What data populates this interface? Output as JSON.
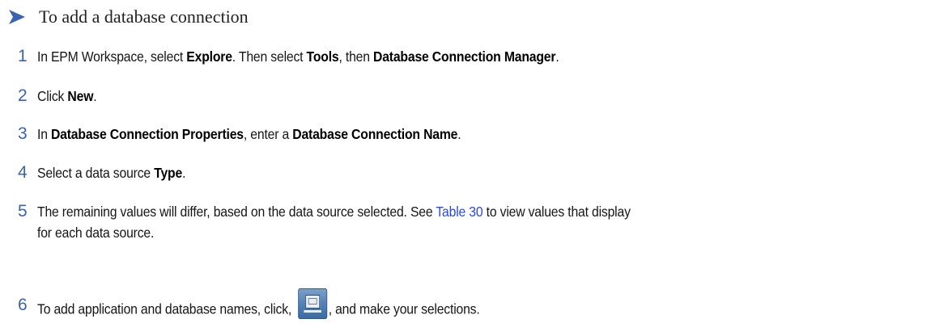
{
  "heading": "To add a database connection",
  "steps": [
    {
      "num": "1",
      "parts": [
        {
          "t": "In EPM Workspace, select ",
          "b": false
        },
        {
          "t": "Explore",
          "b": true
        },
        {
          "t": ". Then select ",
          "b": false
        },
        {
          "t": "Tools",
          "b": true
        },
        {
          "t": ", then ",
          "b": false
        },
        {
          "t": "Database Connection Manager",
          "b": true
        },
        {
          "t": ".",
          "b": false
        }
      ]
    },
    {
      "num": "2",
      "parts": [
        {
          "t": "Click ",
          "b": false
        },
        {
          "t": "New",
          "b": true
        },
        {
          "t": ".",
          "b": false
        }
      ]
    },
    {
      "num": "3",
      "parts": [
        {
          "t": "In ",
          "b": false
        },
        {
          "t": "Database Connection Properties",
          "b": true
        },
        {
          "t": ", enter a ",
          "b": false
        },
        {
          "t": "Database Connection Name",
          "b": true
        },
        {
          "t": ".",
          "b": false
        }
      ]
    },
    {
      "num": "4",
      "parts": [
        {
          "t": "Select a data source ",
          "b": false
        },
        {
          "t": "Type",
          "b": true
        },
        {
          "t": ".",
          "b": false
        }
      ]
    },
    {
      "num": "5",
      "line1_before": "The remaining values will differ, based on the data source selected. See ",
      "link": "Table 30",
      "line1_after": " to view values that display",
      "line2": "for each data source."
    },
    {
      "num": "6",
      "before": "To add application and database names, click, ",
      "icon": "application-browse-icon",
      "after": ", and make your selections."
    }
  ],
  "colors": {
    "step_number": "#3a63b0",
    "link": "#2a49e6",
    "heading_arrow": "#3a63b0"
  }
}
